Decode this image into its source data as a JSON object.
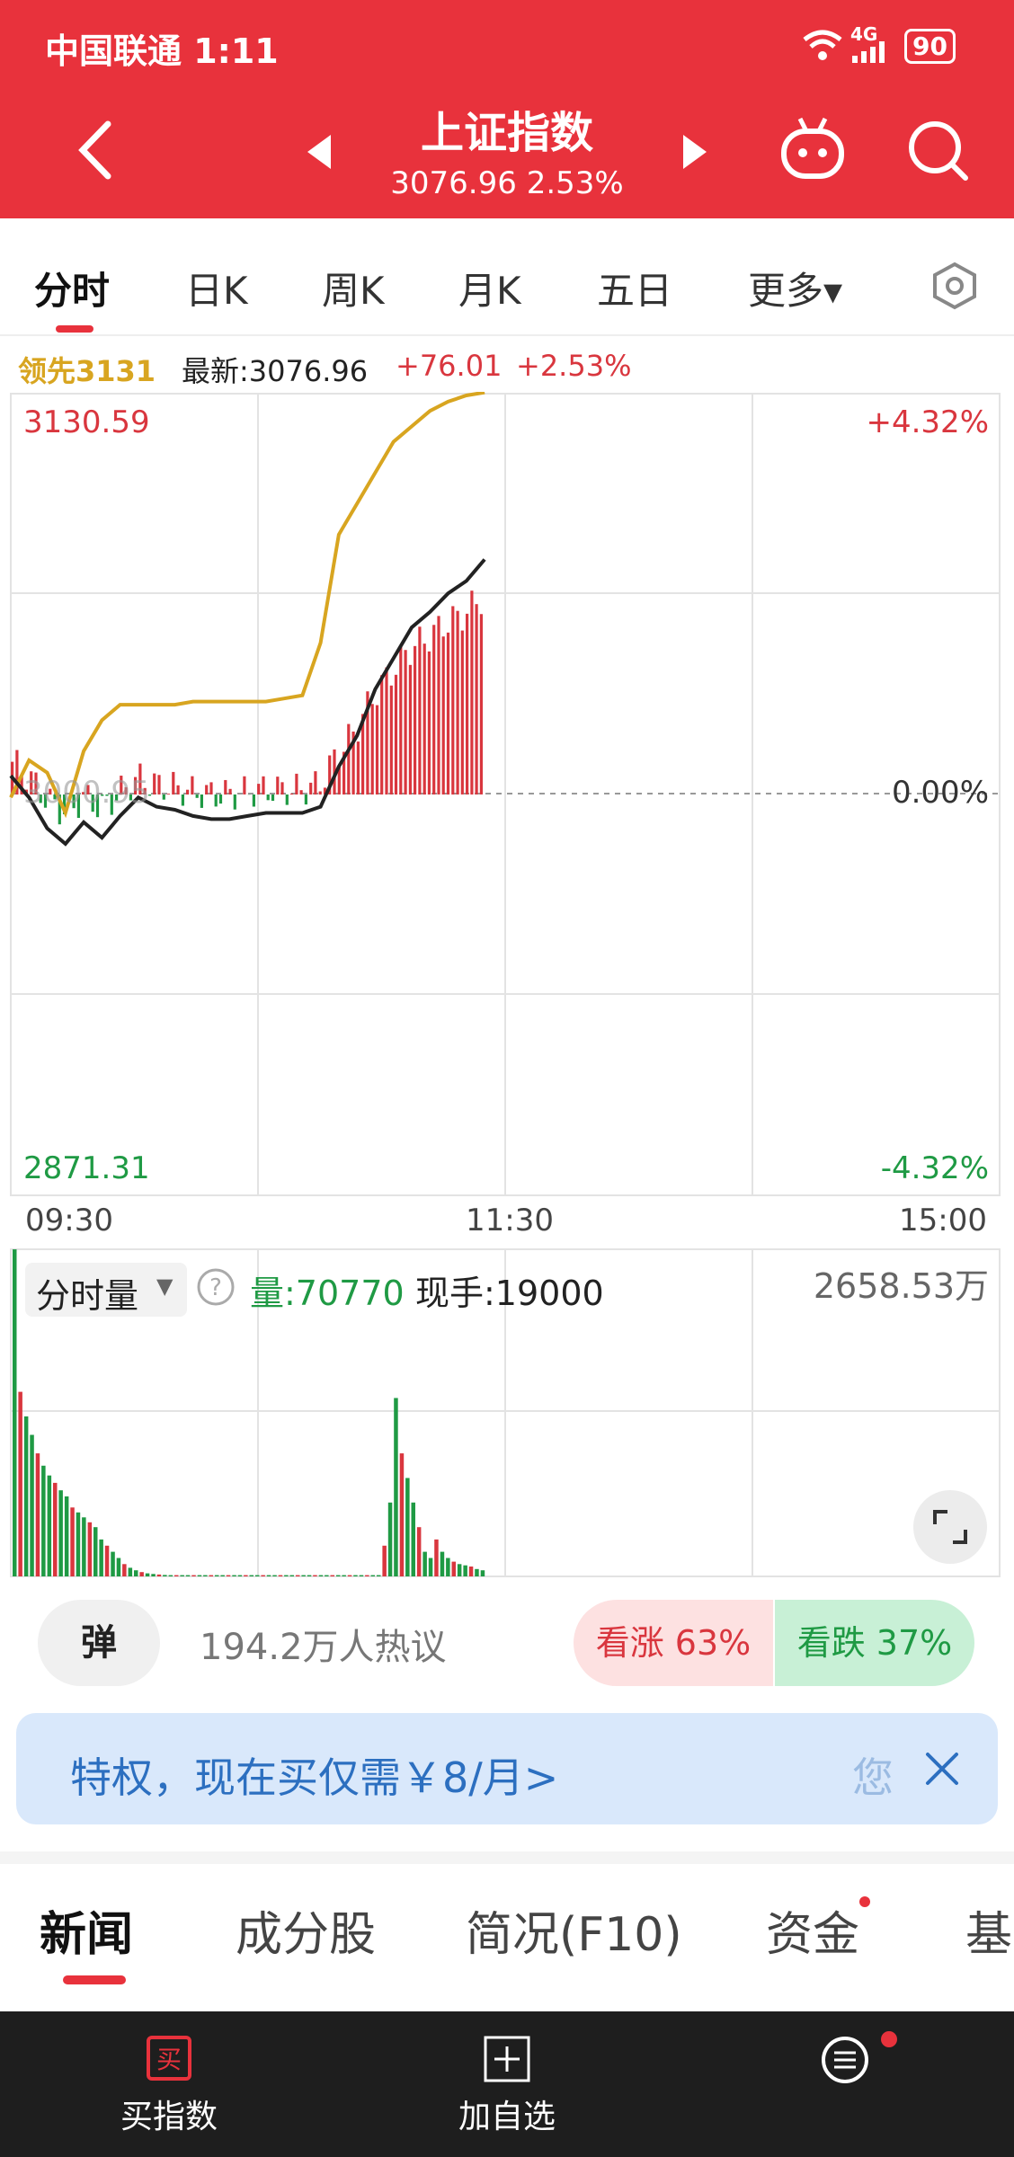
{
  "status_bar": {
    "carrier_time": "中国联通 1:11",
    "network": "4G",
    "battery": "90"
  },
  "header": {
    "title": "上证指数",
    "price_change": "3076.96 2.53%"
  },
  "period_tabs": [
    {
      "label": "分时",
      "active": true
    },
    {
      "label": "日K"
    },
    {
      "label": "周K"
    },
    {
      "label": "月K"
    },
    {
      "label": "五日"
    },
    {
      "label": "更多▾"
    }
  ],
  "info_bar": {
    "leading": "领先3131",
    "latest": "最新:3076.96",
    "change": "+76.01",
    "pct": "+2.53%"
  },
  "price_axis": {
    "high": "3130.59",
    "high_pct": "+4.32%",
    "mid": "3000.95",
    "mid_pct": "0.00%",
    "low": "2871.31",
    "low_pct": "-4.32%"
  },
  "time_axis": [
    "09:30",
    "11:30",
    "15:00"
  ],
  "volume": {
    "selector": "分时量",
    "vol": "量:70770",
    "hand": "现手:19000",
    "max": "2658.53万"
  },
  "sentiment": {
    "bubble": "弹",
    "hot": "194.2万人热议",
    "rise": "看涨 63%",
    "fall": "看跌 37%"
  },
  "banner": {
    "text": "特权，现在买仅需￥8/月>",
    "partial": "您"
  },
  "news_tabs": [
    {
      "label": "新闻",
      "active": true
    },
    {
      "label": "成分股"
    },
    {
      "label": "简况(F10)"
    },
    {
      "label": "资金"
    },
    {
      "label": "基"
    }
  ],
  "bottom_bar": {
    "buy": "买指数",
    "add": "加自选"
  },
  "colors": {
    "header": "#e8323c",
    "up": "#d9363e",
    "down": "#1f9a44",
    "leading_line": "#d8a520",
    "price_line": "#222222"
  },
  "chart_data": [
    {
      "type": "line",
      "title": "上证指数 分时",
      "x_labels": [
        "09:30",
        "11:30",
        "15:00"
      ],
      "ylim": [
        2871.31,
        3130.59
      ],
      "series": [
        {
          "name": "最新",
          "values": [
            3007,
            3000,
            2990,
            2985,
            2992,
            2987,
            2994,
            3000,
            2997,
            2996,
            2994,
            2993,
            2993,
            2994,
            2995,
            2995,
            2995,
            2997,
            3010,
            3020,
            3035,
            3045,
            3055,
            3060,
            3066,
            3070,
            3076.96
          ]
        },
        {
          "name": "领先",
          "values": [
            3000,
            3012,
            3008,
            2995,
            3015,
            3025,
            3030,
            3030,
            3030,
            3030,
            3031,
            3031,
            3031,
            3031,
            3031,
            3032,
            3033,
            3050,
            3085,
            3095,
            3105,
            3115,
            3120,
            3125,
            3128,
            3130,
            3131
          ]
        }
      ]
    },
    {
      "type": "bar",
      "title": "分时量",
      "ylim": [
        0,
        2658.53
      ],
      "series": [
        {
          "name": "分时量",
          "values": [
            2658,
            1500,
            1300,
            1150,
            1000,
            900,
            820,
            760,
            700,
            650,
            560,
            520,
            480,
            440,
            400,
            300,
            250,
            200,
            150,
            100,
            70,
            50,
            35,
            25,
            20,
            15,
            12,
            10,
            10,
            10,
            10,
            10,
            10,
            10,
            10,
            10,
            10,
            10,
            10,
            10,
            10,
            10,
            10,
            10,
            10,
            10,
            10,
            10,
            10,
            10,
            10,
            10,
            10,
            10,
            10,
            10,
            10,
            10,
            10,
            10,
            10,
            10,
            10,
            10,
            250,
            600,
            1450,
            1000,
            800,
            600,
            400,
            200,
            150,
            300,
            200,
            150,
            120,
            100,
            90,
            80,
            60,
            50
          ]
        }
      ]
    }
  ]
}
